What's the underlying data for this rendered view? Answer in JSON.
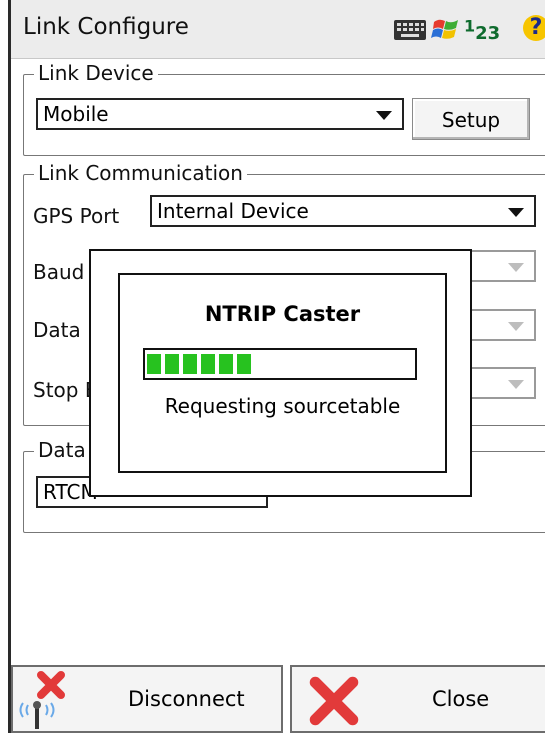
{
  "window": {
    "title": "Link Configure"
  },
  "tray": {
    "keyboard_icon": "keyboard-icon",
    "start_icon": "windows-flag-icon",
    "input_mode": "123",
    "help_icon": "?"
  },
  "link_device": {
    "group_label": "Link Device",
    "device_value": "Mobile",
    "setup_label": "Setup"
  },
  "link_communication": {
    "group_label": "Link Communication",
    "gps_port_label": "GPS Port",
    "gps_port_value": "Internal Device",
    "baud_label": "Baud",
    "data_bits_label": "Data B",
    "stop_bits_label": "Stop B"
  },
  "data_format": {
    "group_label": "Data F",
    "value": "RTCM"
  },
  "dialog": {
    "title": "NTRIP Caster",
    "status": "Requesting sourcetable",
    "progress_segments_filled": 6
  },
  "bottom": {
    "disconnect_label": "Disconnect",
    "close_label": "Close"
  },
  "colors": {
    "progress": "#27c21f",
    "close_x": "#e23a3a"
  }
}
